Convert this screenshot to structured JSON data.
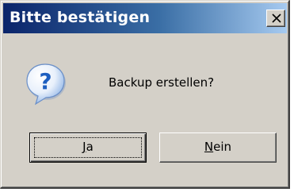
{
  "window": {
    "title": "Bitte bestätigen",
    "close_icon": "close-icon"
  },
  "dialog": {
    "icon": "question-icon",
    "message": "Backup erstellen?"
  },
  "buttons": {
    "yes": {
      "mnemonic": "J",
      "rest": "a"
    },
    "no": {
      "mnemonic": "N",
      "rest": "ein"
    }
  },
  "colors": {
    "face": "#d4d0c8",
    "title_gradient_start": "#0a246a",
    "title_gradient_end": "#a6caf0",
    "icon_blue": "#1e5fc0"
  }
}
